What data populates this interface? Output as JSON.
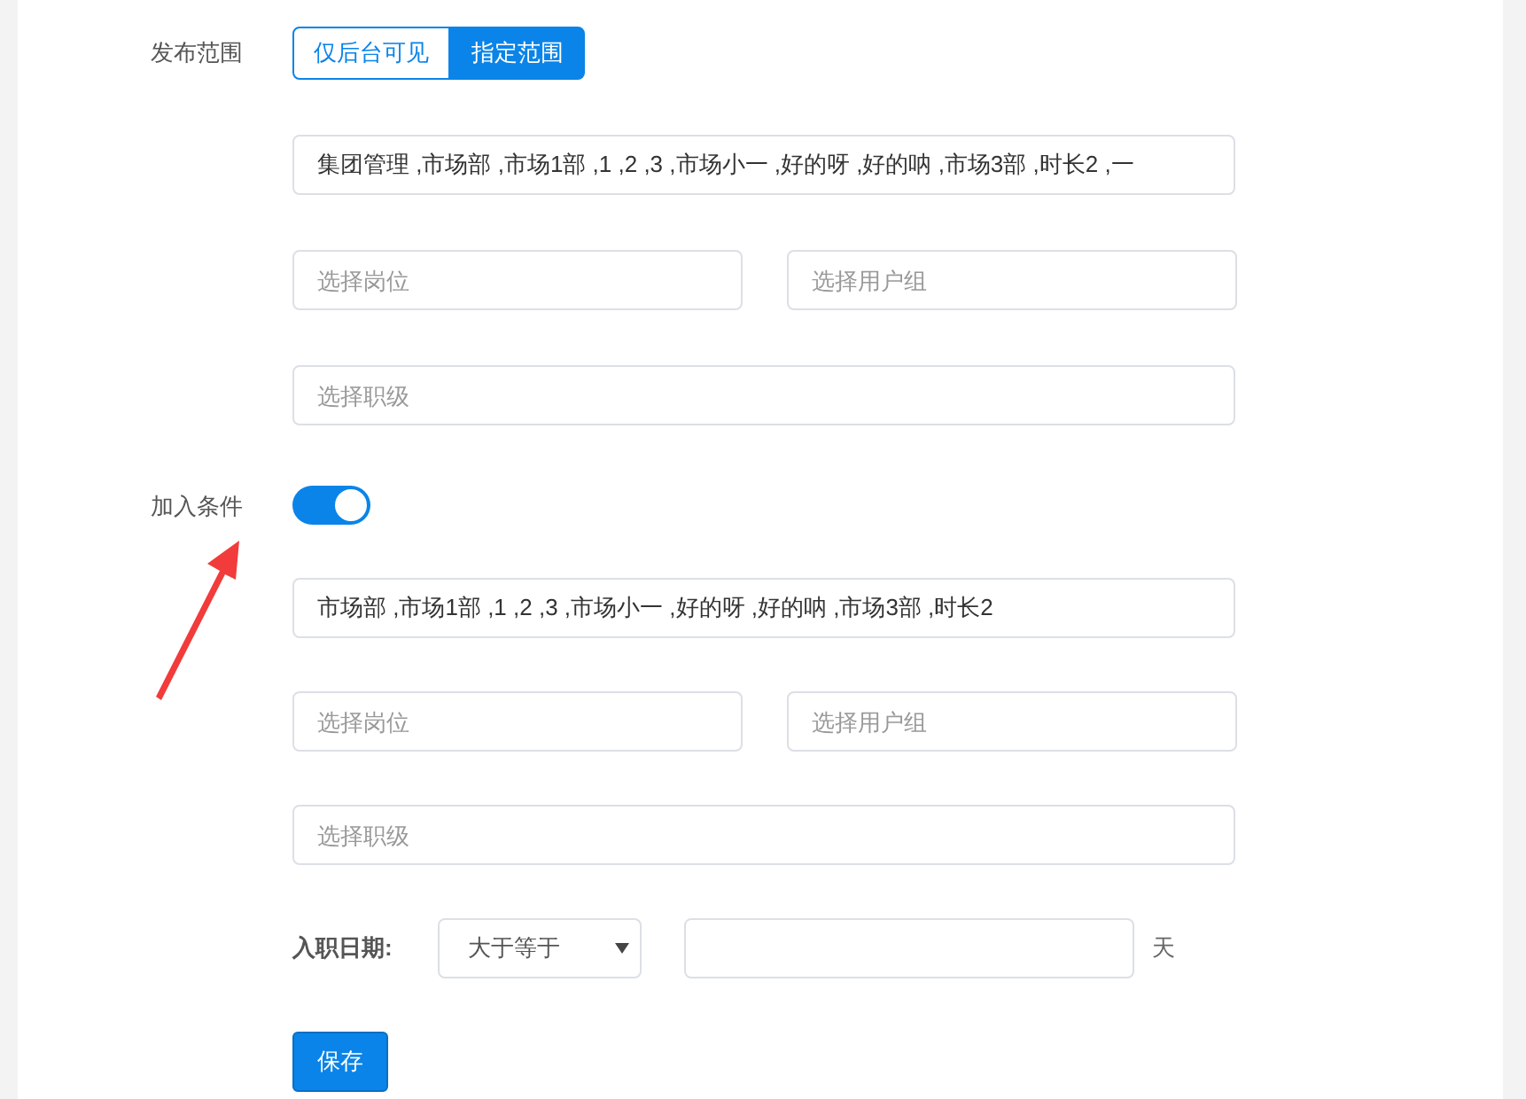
{
  "publish_scope": {
    "label": "发布范围",
    "options": [
      {
        "label": "仅后台可见",
        "selected": false
      },
      {
        "label": "指定范围",
        "selected": true
      }
    ],
    "departments": {
      "value": "集团管理 ,市场部 ,市场1部 ,1 ,2 ,3 ,市场小一 ,好的呀 ,好的呐 ,市场3部 ,时长2 ,一"
    },
    "position": {
      "placeholder": "选择岗位"
    },
    "user_group": {
      "placeholder": "选择用户组"
    },
    "rank": {
      "placeholder": "选择职级"
    }
  },
  "join_condition": {
    "label": "加入条件",
    "on": true,
    "departments": {
      "value": "市场部 ,市场1部 ,1 ,2 ,3 ,市场小一 ,好的呀 ,好的呐 ,市场3部 ,时长2"
    },
    "position": {
      "placeholder": "选择岗位"
    },
    "user_group": {
      "placeholder": "选择用户组"
    },
    "rank": {
      "placeholder": "选择职级"
    },
    "hire_date": {
      "label": "入职日期:",
      "operator": "大于等于",
      "unit": "天"
    }
  },
  "save_button": "保存"
}
